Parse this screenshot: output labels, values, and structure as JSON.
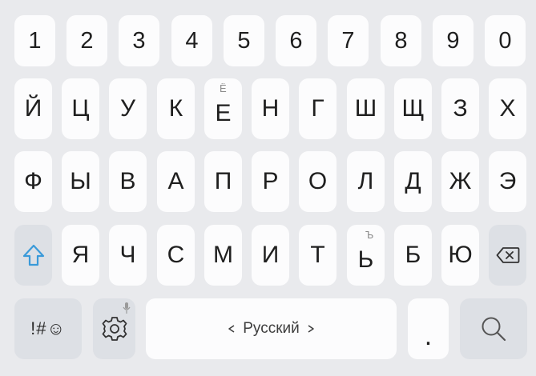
{
  "keyboard": {
    "number_row": [
      "1",
      "2",
      "3",
      "4",
      "5",
      "6",
      "7",
      "8",
      "9",
      "0"
    ],
    "row1": [
      {
        "label": "Й"
      },
      {
        "label": "Ц"
      },
      {
        "label": "У"
      },
      {
        "label": "К"
      },
      {
        "label": "Е",
        "sub": "Ё"
      },
      {
        "label": "Н"
      },
      {
        "label": "Г"
      },
      {
        "label": "Ш"
      },
      {
        "label": "Щ"
      },
      {
        "label": "З"
      },
      {
        "label": "Х"
      }
    ],
    "row2": [
      "Ф",
      "Ы",
      "В",
      "А",
      "П",
      "Р",
      "О",
      "Л",
      "Д",
      "Ж",
      "Э"
    ],
    "row3": [
      {
        "label": "Я"
      },
      {
        "label": "Ч"
      },
      {
        "label": "С"
      },
      {
        "label": "М"
      },
      {
        "label": "И"
      },
      {
        "label": "Т"
      },
      {
        "label": "Ь",
        "sub": "Ъ"
      },
      {
        "label": "Б"
      },
      {
        "label": "Ю"
      }
    ],
    "bottom": {
      "symbols_label": "!#☺",
      "space_label": "Русский",
      "period_label": "."
    },
    "icons": {
      "shift": "shift-arrow-icon",
      "backspace": "backspace-icon",
      "settings": "gear-icon",
      "mic": "microphone-icon",
      "search": "search-icon",
      "lang_prev": "triangle-left-icon",
      "lang_next": "triangle-right-icon"
    },
    "colors": {
      "background": "#e9eaed",
      "key": "#fcfcfd",
      "func_key": "#dde0e5",
      "shift_accent": "#3a9ad9"
    }
  }
}
